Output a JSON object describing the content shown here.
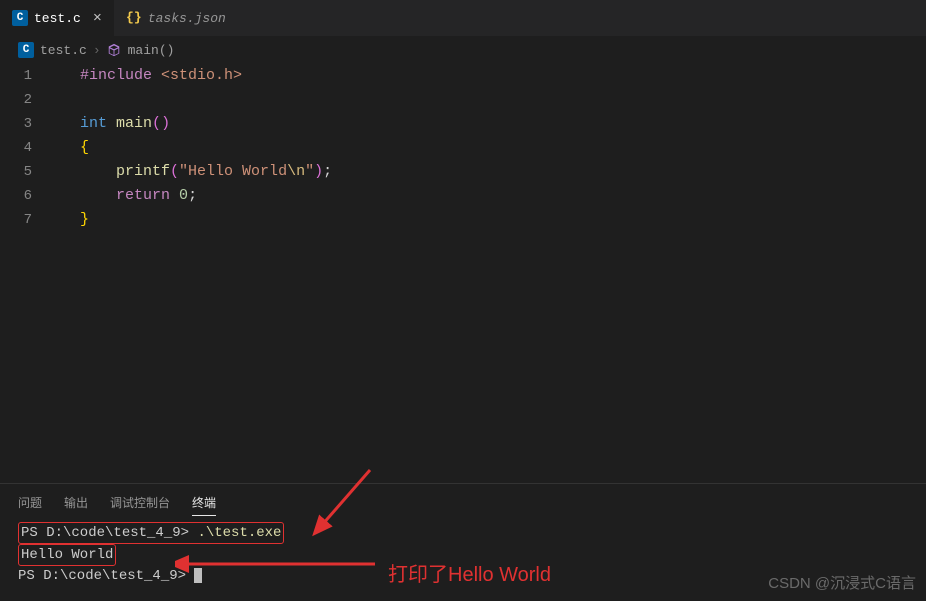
{
  "tabs": [
    {
      "label": "test.c",
      "icon": "C"
    },
    {
      "label": "tasks.json",
      "icon": "{}"
    }
  ],
  "breadcrumb": {
    "file": "test.c",
    "symbol": "main()"
  },
  "lines": [
    "1",
    "2",
    "3",
    "4",
    "5",
    "6",
    "7"
  ],
  "code": {
    "l1a": "#include",
    "l1b": " <stdio.h>",
    "l3a": "int",
    "l3b": " ",
    "l3c": "main",
    "l3d": "(",
    "l3e": ")",
    "l4": "{",
    "l5a": "    ",
    "l5b": "printf",
    "l5c": "(",
    "l5d": "\"Hello World",
    "l5e": "\\n",
    "l5f": "\"",
    "l5g": ")",
    "l5h": ";",
    "l6a": "    ",
    "l6b": "return",
    "l6c": " ",
    "l6d": "0",
    "l6e": ";",
    "l7": "}"
  },
  "panelTabs": [
    "问题",
    "输出",
    "调试控制台",
    "终端"
  ],
  "terminal": {
    "prompt1": "PS D:\\code\\test_4_9>",
    "cmd": ".\\test.exe",
    "output": "Hello World",
    "prompt2": "PS D:\\code\\test_4_9>"
  },
  "annotation": "打印了Hello World",
  "watermark": "CSDN @沉浸式C语言"
}
